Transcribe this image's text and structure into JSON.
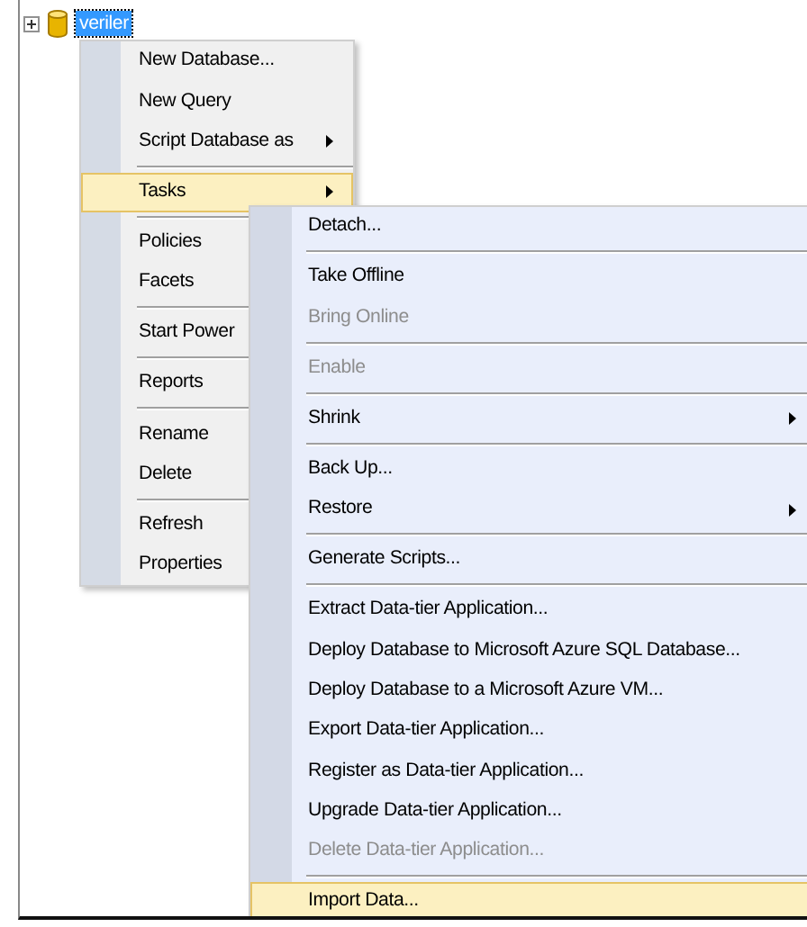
{
  "tree": {
    "label": "veriler",
    "selected": true,
    "expanded": false
  },
  "context_menu": {
    "items": [
      {
        "kind": "item",
        "label": "New Database...",
        "disabled": false,
        "selected": false
      },
      {
        "kind": "item",
        "label": "New Query",
        "disabled": false,
        "selected": false
      },
      {
        "kind": "item",
        "label": "Script Database as",
        "submenu": true,
        "disabled": false,
        "selected": false
      },
      {
        "kind": "separator"
      },
      {
        "kind": "item",
        "label": "Tasks",
        "submenu": true,
        "disabled": false,
        "selected": true
      },
      {
        "kind": "separator"
      },
      {
        "kind": "item",
        "label": "Policies",
        "disabled": false,
        "selected": false
      },
      {
        "kind": "item",
        "label": "Facets",
        "disabled": false,
        "selected": false
      },
      {
        "kind": "separator"
      },
      {
        "kind": "item",
        "label": "Start Power",
        "disabled": false,
        "selected": false
      },
      {
        "kind": "separator"
      },
      {
        "kind": "item",
        "label": "Reports",
        "disabled": false,
        "selected": false
      },
      {
        "kind": "separator"
      },
      {
        "kind": "item",
        "label": "Rename",
        "disabled": false,
        "selected": false
      },
      {
        "kind": "item",
        "label": "Delete",
        "disabled": false,
        "selected": false
      },
      {
        "kind": "separator"
      },
      {
        "kind": "item",
        "label": "Refresh",
        "disabled": false,
        "selected": false
      },
      {
        "kind": "item",
        "label": "Properties",
        "disabled": false,
        "selected": false
      }
    ]
  },
  "tasks_submenu": {
    "items": [
      {
        "kind": "item",
        "label": "Detach...",
        "disabled": false,
        "selected": false
      },
      {
        "kind": "separator"
      },
      {
        "kind": "item",
        "label": "Take Offline",
        "disabled": false,
        "selected": false
      },
      {
        "kind": "item",
        "label": "Bring Online",
        "disabled": true,
        "selected": false
      },
      {
        "kind": "separator"
      },
      {
        "kind": "item",
        "label": "Enable",
        "disabled": true,
        "selected": false
      },
      {
        "kind": "separator"
      },
      {
        "kind": "item",
        "label": "Shrink",
        "submenu": true,
        "disabled": false,
        "selected": false
      },
      {
        "kind": "separator"
      },
      {
        "kind": "item",
        "label": "Back Up...",
        "disabled": false,
        "selected": false
      },
      {
        "kind": "item",
        "label": "Restore",
        "submenu": true,
        "disabled": false,
        "selected": false
      },
      {
        "kind": "separator"
      },
      {
        "kind": "item",
        "label": "Generate Scripts...",
        "disabled": false,
        "selected": false
      },
      {
        "kind": "separator"
      },
      {
        "kind": "item",
        "label": "Extract Data-tier Application...",
        "disabled": false,
        "selected": false
      },
      {
        "kind": "item",
        "label": "Deploy Database to Microsoft Azure SQL Database...",
        "disabled": false,
        "selected": false
      },
      {
        "kind": "item",
        "label": "Deploy Database to a Microsoft Azure VM...",
        "disabled": false,
        "selected": false
      },
      {
        "kind": "item",
        "label": "Export Data-tier Application...",
        "disabled": false,
        "selected": false
      },
      {
        "kind": "item",
        "label": "Register as Data-tier Application...",
        "disabled": false,
        "selected": false
      },
      {
        "kind": "item",
        "label": "Upgrade Data-tier Application...",
        "disabled": false,
        "selected": false
      },
      {
        "kind": "item",
        "label": "Delete Data-tier Application...",
        "disabled": true,
        "selected": false
      },
      {
        "kind": "separator"
      },
      {
        "kind": "item",
        "label": "Import Data...",
        "disabled": false,
        "selected": true
      }
    ]
  }
}
